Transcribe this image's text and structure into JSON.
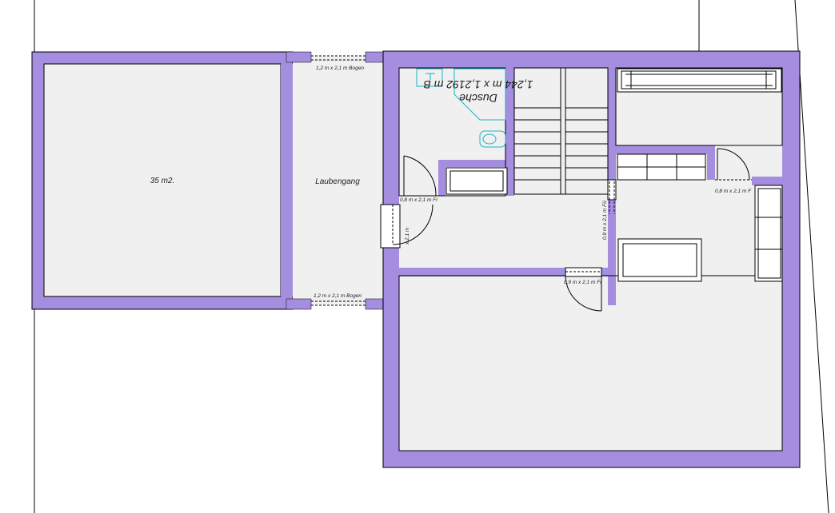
{
  "colors": {
    "wall": "#a58ddf",
    "floor": "#f0f0f0",
    "line": "#000000",
    "fixture": "#19b3c4",
    "background": "#ffffff"
  },
  "rooms": {
    "left_room_area": "35 m2.",
    "corridor": "Laubengang"
  },
  "openings": {
    "arch_top": "1,2 m x 2,1 m Bogen",
    "arch_bottom": "1,2 m x 2,1 m Bogen",
    "door_entry": "0,8 m x 2,1 m Fr",
    "door_west_vertical": "x 2,1 m",
    "door_right_room": "0,8 m x 2,1 m F",
    "door_stair_vertical": "0,9 m x 2,1 m Fü",
    "door_lower": "0,9 m x 2,1 m Fr"
  },
  "bathroom": {
    "name": "Dusche",
    "dimensions": "1,244 m x 1,2192 m B"
  }
}
